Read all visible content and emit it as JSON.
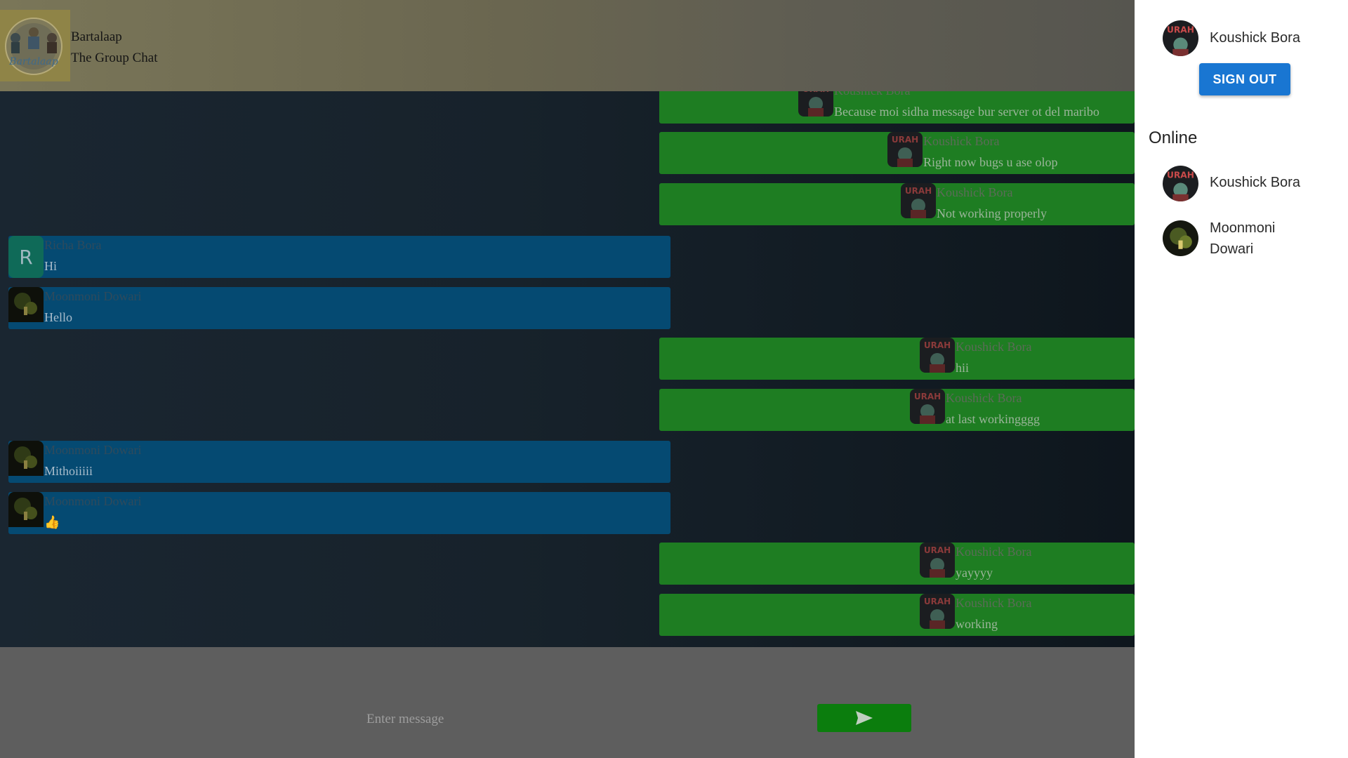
{
  "app": {
    "title": "Bartalaap",
    "subtitle": "The Group Chat"
  },
  "messages": [
    {
      "side": "right",
      "name": "Koushick Bora",
      "text": "Because moi sidha message bur server ot del maribo",
      "avatar": "urah-avatar-icon"
    },
    {
      "side": "right",
      "name": "Koushick Bora",
      "text": "Right now bugs u ase olop",
      "avatar": "urah-avatar-icon"
    },
    {
      "side": "right",
      "name": "Koushick Bora",
      "text": "Not working properly",
      "avatar": "urah-avatar-icon"
    },
    {
      "side": "left",
      "name": "Richa Bora",
      "text": "Hi",
      "avatar": "letter-avatar",
      "letter": "R"
    },
    {
      "side": "left",
      "name": "Moonmoni Dowari",
      "text": "Hello",
      "avatar": "night-photo-avatar"
    },
    {
      "side": "right",
      "name": "Koushick Bora",
      "text": "hii",
      "avatar": "urah-avatar-icon"
    },
    {
      "side": "right",
      "name": "Koushick Bora",
      "text": "at last workingggg",
      "avatar": "urah-avatar-icon"
    },
    {
      "side": "left",
      "name": "Moonmoni Dowari",
      "text": "Mithoiiiii",
      "avatar": "night-photo-avatar"
    },
    {
      "side": "left",
      "name": "Moonmoni Dowari",
      "text": "👍",
      "avatar": "night-photo-avatar"
    },
    {
      "side": "right",
      "name": "Koushick Bora",
      "text": "yayyyy",
      "avatar": "urah-avatar-icon"
    },
    {
      "side": "right",
      "name": "Koushick Bora",
      "text": "working",
      "avatar": "urah-avatar-icon"
    }
  ],
  "composer": {
    "placeholder": "Enter message",
    "send_icon": "send-icon"
  },
  "panel": {
    "current_user": {
      "name": "Koushick Bora"
    },
    "signout_label": "SIGN OUT",
    "online_heading": "Online",
    "online_users": [
      {
        "name": "Koushick Bora"
      },
      {
        "name": "Moonmoni\nDowari"
      }
    ]
  },
  "colors": {
    "sent_bubble": "#1e7d22",
    "received_bubble": "#054a72",
    "send_button": "#0b7d0d",
    "signout_button": "#1976d2"
  }
}
